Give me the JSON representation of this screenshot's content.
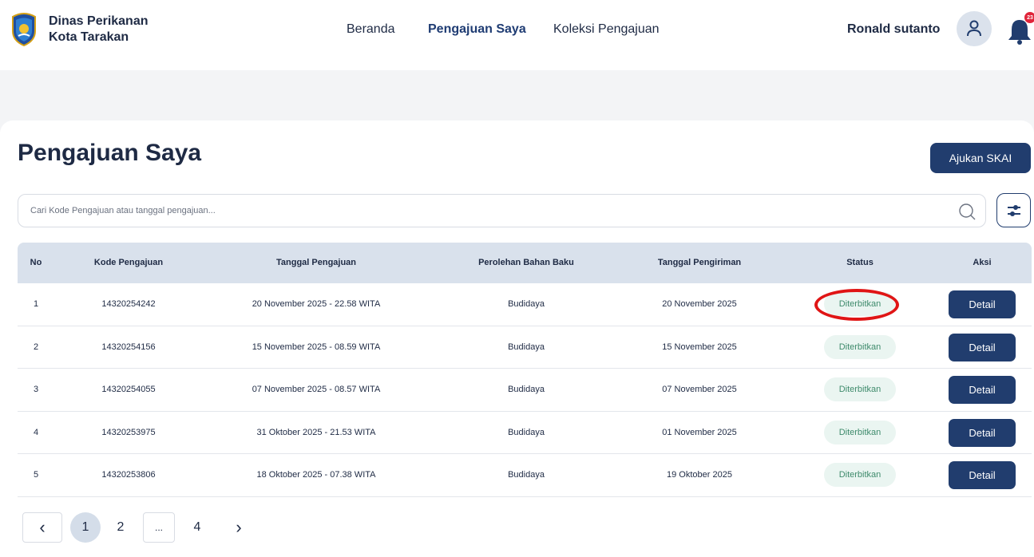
{
  "header": {
    "brand_line1": "Dinas Perikanan",
    "brand_line2": "Kota Tarakan",
    "nav": [
      "Beranda",
      "Pengajuan Saya",
      "Koleksi Pengajuan"
    ],
    "active_nav": "Pengajuan Saya",
    "user_name": "Ronald sutanto",
    "notification_count": "23"
  },
  "main": {
    "title": "Pengajuan Saya",
    "primary_button": "Ajukan SKAI",
    "search_placeholder": "Cari Kode Pengajuan atau tanggal pengajuan..."
  },
  "table": {
    "columns": [
      "No",
      "Kode Pengajuan",
      "Tanggal Pengajuan",
      "Perolehan Bahan Baku",
      "Tanggal Pengiriman",
      "Status",
      "Aksi"
    ],
    "rows": [
      {
        "no": "1",
        "kode": "14320254242",
        "tanggal": "20 November 2025 - 22.58 WITA",
        "bahan": "Budidaya",
        "kirim": "20 November 2025",
        "status": "Diterbitkan",
        "aksi": "Detail"
      },
      {
        "no": "2",
        "kode": "14320254156",
        "tanggal": "15 November 2025 - 08.59 WITA",
        "bahan": "Budidaya",
        "kirim": "15 November 2025",
        "status": "Diterbitkan",
        "aksi": "Detail"
      },
      {
        "no": "3",
        "kode": "14320254055",
        "tanggal": "07 November 2025 - 08.57 WITA",
        "bahan": "Budidaya",
        "kirim": "07 November 2025",
        "status": "Diterbitkan",
        "aksi": "Detail"
      },
      {
        "no": "4",
        "kode": "14320253975",
        "tanggal": "31 Oktober 2025 - 21.53 WITA",
        "bahan": "Budidaya",
        "kirim": "01 November 2025",
        "status": "Diterbitkan",
        "aksi": "Detail"
      },
      {
        "no": "5",
        "kode": "14320253806",
        "tanggal": "18 Oktober 2025 - 07.38 WITA",
        "bahan": "Budidaya",
        "kirim": "19 Oktober 2025",
        "status": "Diterbitkan",
        "aksi": "Detail"
      }
    ]
  },
  "pagination": {
    "prev": "‹",
    "pages": [
      "1",
      "2",
      "...",
      "4"
    ],
    "current": "1",
    "next": "›"
  },
  "colors": {
    "primary": "#213d6e",
    "status_bg": "#eaf5f1",
    "status_text": "#3f8b6c",
    "highlight": "#e01515",
    "notification": "#e0243a"
  },
  "icons": [
    "logo-emblem",
    "user-icon",
    "bell-icon",
    "search-icon",
    "filter-sliders-icon",
    "chevron-left-icon",
    "chevron-right-icon"
  ]
}
